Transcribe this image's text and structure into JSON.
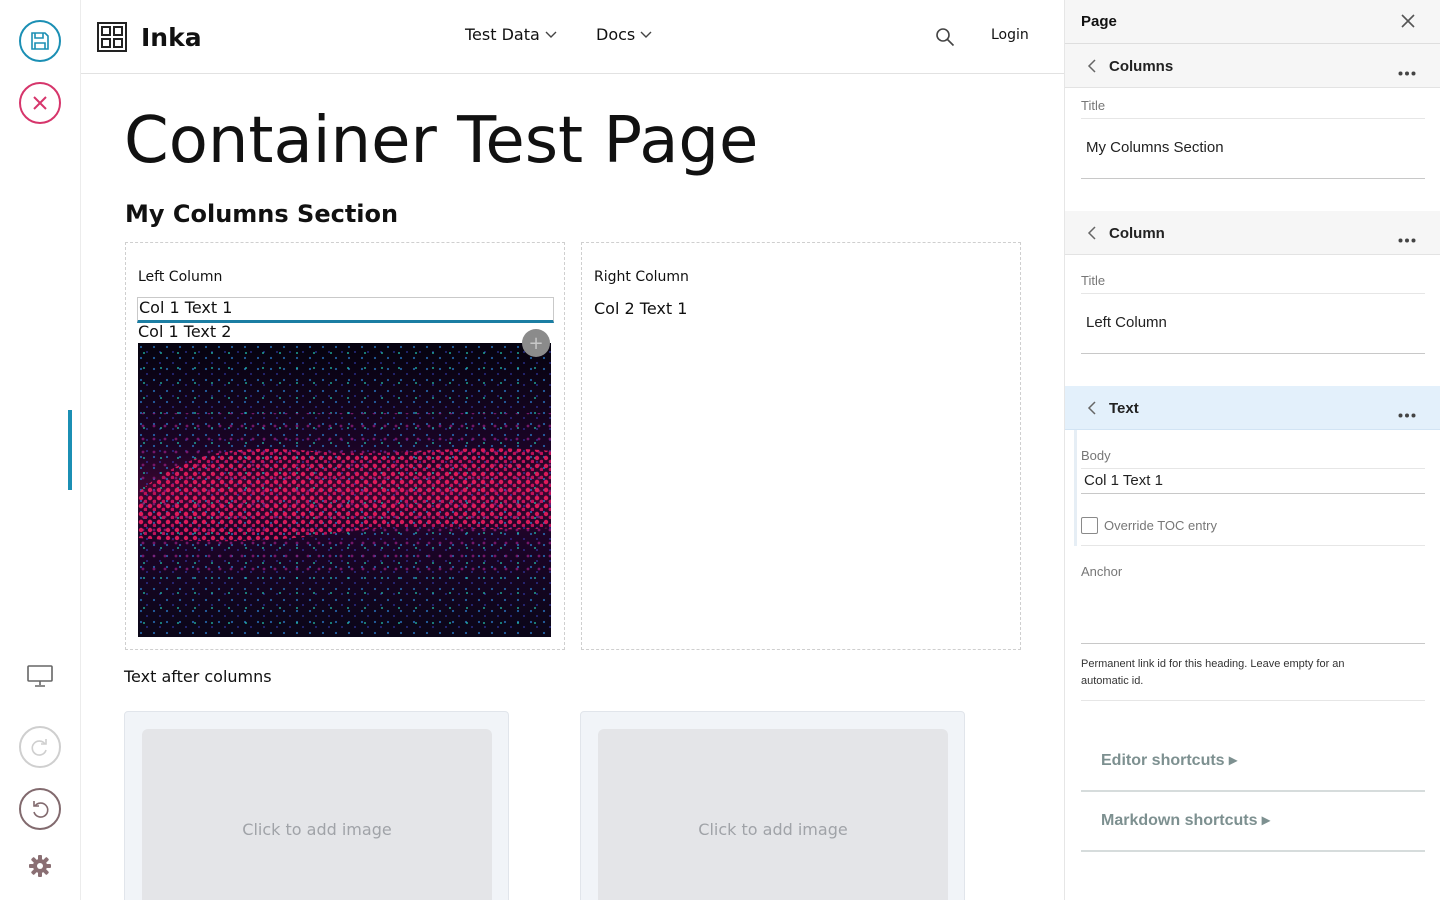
{
  "site": {
    "name": "Inka",
    "nav": [
      {
        "label": "Test Data"
      },
      {
        "label": "Docs"
      }
    ],
    "login": "Login"
  },
  "main": {
    "page_title": "Container Test Page",
    "section_title": "My Columns Section",
    "left_column": {
      "title": "Left Column",
      "texts": [
        "Col 1 Text 1",
        "Col 1 Text 2"
      ]
    },
    "right_column": {
      "title": "Right Column",
      "texts": [
        "Col 2 Text 1"
      ]
    },
    "after_text": "Text after columns",
    "image_cards": [
      {
        "placeholder": "Click to add image"
      },
      {
        "placeholder": "Click to add image"
      }
    ]
  },
  "panel": {
    "title": "Page",
    "sections": [
      {
        "title": "Columns",
        "field_label": "Title",
        "field_value": "My Columns Section"
      },
      {
        "title": "Column",
        "field_label": "Title",
        "field_value": "Left Column"
      },
      {
        "title": "Text",
        "field_label": "Body",
        "field_value": "Col 1 Text 1"
      }
    ],
    "override_label": "Override TOC entry",
    "override_checked": false,
    "anchor_label": "Anchor",
    "anchor_help": "Permanent link id for this heading. Leave empty for an automatic id.",
    "editor_shortcuts": "Editor shortcuts ▸",
    "markdown_shortcuts": "Markdown shortcuts ▸"
  },
  "colors": {
    "accent": "#1b8fb4",
    "cancel": "#d6356b",
    "active_section": "#e3f0fb"
  },
  "icons": [
    "save-icon",
    "close-circle-icon",
    "display-icon",
    "redo-icon",
    "undo-icon",
    "gear-icon",
    "search-icon",
    "chevron-down-icon",
    "chevron-left-icon",
    "more-icon",
    "close-icon",
    "plus-icon",
    "logo-icon"
  ]
}
